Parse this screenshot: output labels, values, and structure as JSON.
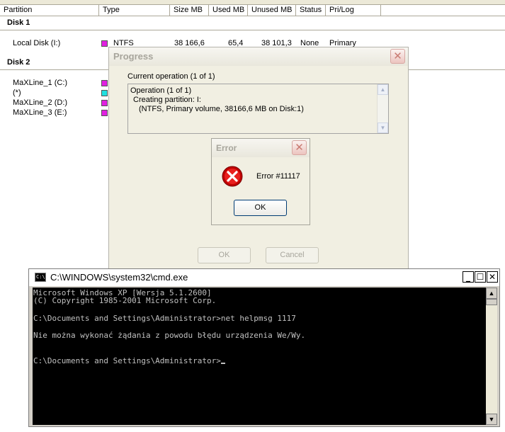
{
  "columns": [
    "Partition",
    "Type",
    "Size MB",
    "Used MB",
    "Unused MB",
    "Status",
    "Pri/Log"
  ],
  "disks": [
    {
      "label": "Disk 1",
      "partitions": [
        {
          "name": "Local Disk (I:)",
          "color": "#e020e0",
          "type": "NTFS",
          "size": "38 166,6",
          "used": "65,4",
          "unused": "38 101,3",
          "status": "None",
          "prilog": "Primary"
        }
      ]
    },
    {
      "label": "Disk 2",
      "partitions": [
        {
          "name": "MaXLine_1 (C:)",
          "color": "#e020e0"
        },
        {
          "name": "(*)",
          "color": "#20e0e0"
        },
        {
          "name": "MaXLine_2 (D:)",
          "color": "#e020e0"
        },
        {
          "name": "MaXLine_3 (E:)",
          "color": "#e020e0"
        }
      ]
    }
  ],
  "progress": {
    "title": "Progress",
    "current_label": "Current operation (1 of 1)",
    "log_lines": [
      "Operation (1 of 1)",
      "Creating partition: I:",
      "(NTFS, Primary volume, 38166,6 MB on Disk:1)"
    ],
    "ok_label": "OK",
    "cancel_label": "Cancel"
  },
  "error": {
    "title": "Error",
    "message": "Error #11117",
    "ok_label": "OK"
  },
  "cmd": {
    "title": "C:\\WINDOWS\\system32\\cmd.exe",
    "icon_text": "C:\\",
    "lines": [
      "Microsoft Windows XP [Wersja 5.1.2600]",
      "(C) Copyright 1985-2001 Microsoft Corp.",
      "",
      "C:\\Documents and Settings\\Administrator>net helpmsg 1117",
      "",
      "Nie można wykonać żądania z powodu błędu urządzenia We/Wy.",
      "",
      "",
      "C:\\Documents and Settings\\Administrator>"
    ]
  }
}
